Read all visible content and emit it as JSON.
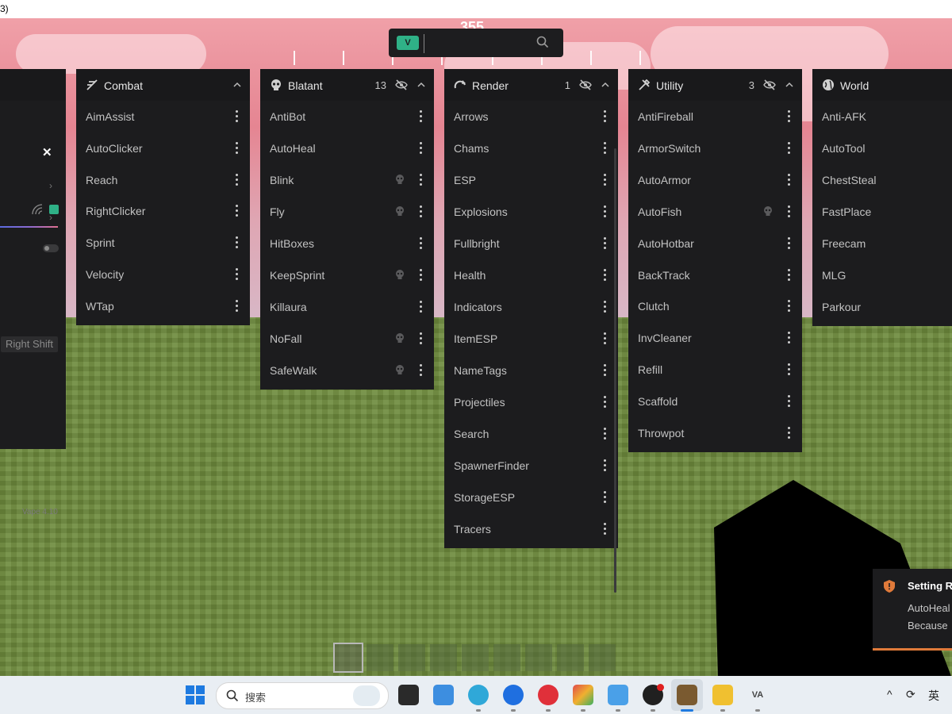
{
  "window": {
    "title_fragment": "3)"
  },
  "hud": {
    "compass_value": "355"
  },
  "search": {
    "placeholder": "",
    "logo_text": "V"
  },
  "settings_panel": {
    "right_shift_label": "Right Shift",
    "version": "Vape 4.10"
  },
  "panels": [
    {
      "title": "Combat",
      "count": "",
      "items": [
        {
          "label": "AimAssist"
        },
        {
          "label": "AutoClicker"
        },
        {
          "label": "Reach"
        },
        {
          "label": "RightClicker"
        },
        {
          "label": "Sprint"
        },
        {
          "label": "Velocity"
        },
        {
          "label": "WTap"
        }
      ]
    },
    {
      "title": "Blatant",
      "count": "13",
      "items": [
        {
          "label": "AntiBot"
        },
        {
          "label": "AutoHeal"
        },
        {
          "label": "Blink",
          "flag": true
        },
        {
          "label": "Fly",
          "flag": true
        },
        {
          "label": "HitBoxes"
        },
        {
          "label": "KeepSprint",
          "flag": true
        },
        {
          "label": "Killaura"
        },
        {
          "label": "NoFall",
          "flag": true
        },
        {
          "label": "SafeWalk",
          "flag": true
        }
      ]
    },
    {
      "title": "Render",
      "count": "1",
      "items": [
        {
          "label": "Arrows"
        },
        {
          "label": "Chams"
        },
        {
          "label": "ESP"
        },
        {
          "label": "Explosions"
        },
        {
          "label": "Fullbright"
        },
        {
          "label": "Health"
        },
        {
          "label": "Indicators"
        },
        {
          "label": "ItemESP"
        },
        {
          "label": "NameTags"
        },
        {
          "label": "Projectiles"
        },
        {
          "label": "Search"
        },
        {
          "label": "SpawnerFinder"
        },
        {
          "label": "StorageESP"
        },
        {
          "label": "Tracers"
        }
      ]
    },
    {
      "title": "Utility",
      "count": "3",
      "items": [
        {
          "label": "AntiFireball"
        },
        {
          "label": "ArmorSwitch"
        },
        {
          "label": "AutoArmor"
        },
        {
          "label": "AutoFish",
          "flag": true
        },
        {
          "label": "AutoHotbar"
        },
        {
          "label": "BackTrack"
        },
        {
          "label": "Clutch"
        },
        {
          "label": "InvCleaner"
        },
        {
          "label": "Refill"
        },
        {
          "label": "Scaffold"
        },
        {
          "label": "Throwpot"
        }
      ]
    },
    {
      "title": "World",
      "count": "",
      "items": [
        {
          "label": "Anti-AFK"
        },
        {
          "label": "AutoTool"
        },
        {
          "label": "ChestSteal"
        },
        {
          "label": "FastPlace"
        },
        {
          "label": "Freecam"
        },
        {
          "label": "MLG"
        },
        {
          "label": "Parkour"
        }
      ]
    }
  ],
  "toast": {
    "title": "Setting R",
    "line1": "AutoHeal",
    "line2": "Because"
  },
  "taskbar": {
    "search_placeholder": "搜索",
    "ime": "英"
  },
  "colors": {
    "panel_bg": "#1c1c1e",
    "accent": "#2fb187",
    "warning": "#e07a3a"
  }
}
